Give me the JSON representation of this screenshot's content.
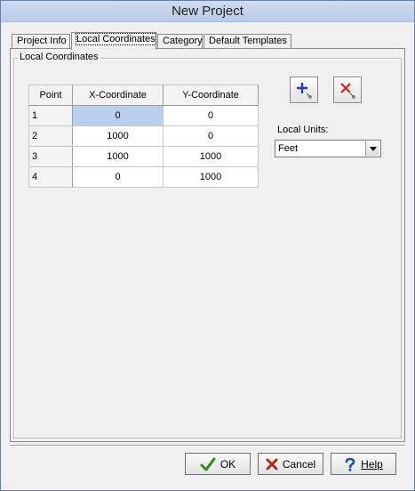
{
  "window": {
    "title": "New Project"
  },
  "tabs": [
    {
      "label": "Project Info",
      "active": false
    },
    {
      "label": "Local Coordinates",
      "active": true
    },
    {
      "label": "Category",
      "active": false
    },
    {
      "label": "Default Templates",
      "active": false
    }
  ],
  "group": {
    "label": "Local Coordinates"
  },
  "grid": {
    "columns": [
      "Point",
      "X-Coordinate",
      "Y-Coordinate"
    ],
    "rows": [
      {
        "point": "1",
        "x": "0",
        "y": "0",
        "selected_cell": "x"
      },
      {
        "point": "2",
        "x": "1000",
        "y": "0"
      },
      {
        "point": "3",
        "x": "1000",
        "y": "1000"
      },
      {
        "point": "4",
        "x": "0",
        "y": "1000"
      }
    ]
  },
  "toolbar": {
    "add_icon": "add-point-icon",
    "delete_icon": "delete-point-icon"
  },
  "units": {
    "label": "Local Units:",
    "selected": "Feet"
  },
  "buttons": {
    "ok": {
      "label": "OK",
      "icon": "checkmark-icon",
      "color": "#2e8b1e"
    },
    "cancel": {
      "label": "Cancel",
      "icon": "x-mark-icon",
      "color": "#b0281c"
    },
    "help": {
      "label": "Help",
      "icon": "question-mark-icon",
      "color": "#1c4fa0"
    }
  }
}
